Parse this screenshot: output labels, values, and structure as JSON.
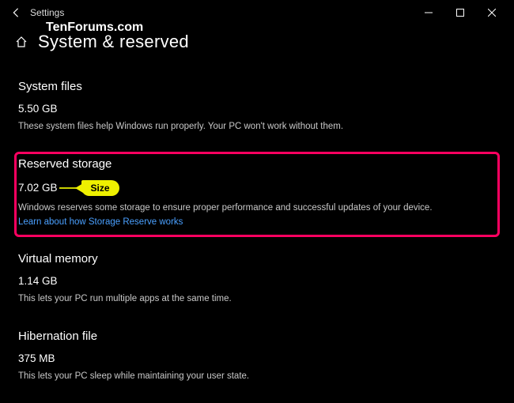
{
  "window": {
    "title": "Settings"
  },
  "watermark": "TenForums.com",
  "header": {
    "page_title": "System & reserved"
  },
  "sections": {
    "system_files": {
      "heading": "System files",
      "size": "5.50 GB",
      "desc": "These system files help Windows run properly. Your PC won't work without them."
    },
    "reserved_storage": {
      "heading": "Reserved storage",
      "size": "7.02 GB",
      "desc": "Windows reserves some storage to ensure proper performance and successful updates of your device.",
      "link": "Learn about how Storage Reserve works",
      "callout_label": "Size"
    },
    "virtual_memory": {
      "heading": "Virtual memory",
      "size": "1.14 GB",
      "desc": "This lets your PC run multiple apps at the same time."
    },
    "hibernation_file": {
      "heading": "Hibernation file",
      "size": "375 MB",
      "desc": "This lets your PC sleep while maintaining your user state."
    }
  }
}
